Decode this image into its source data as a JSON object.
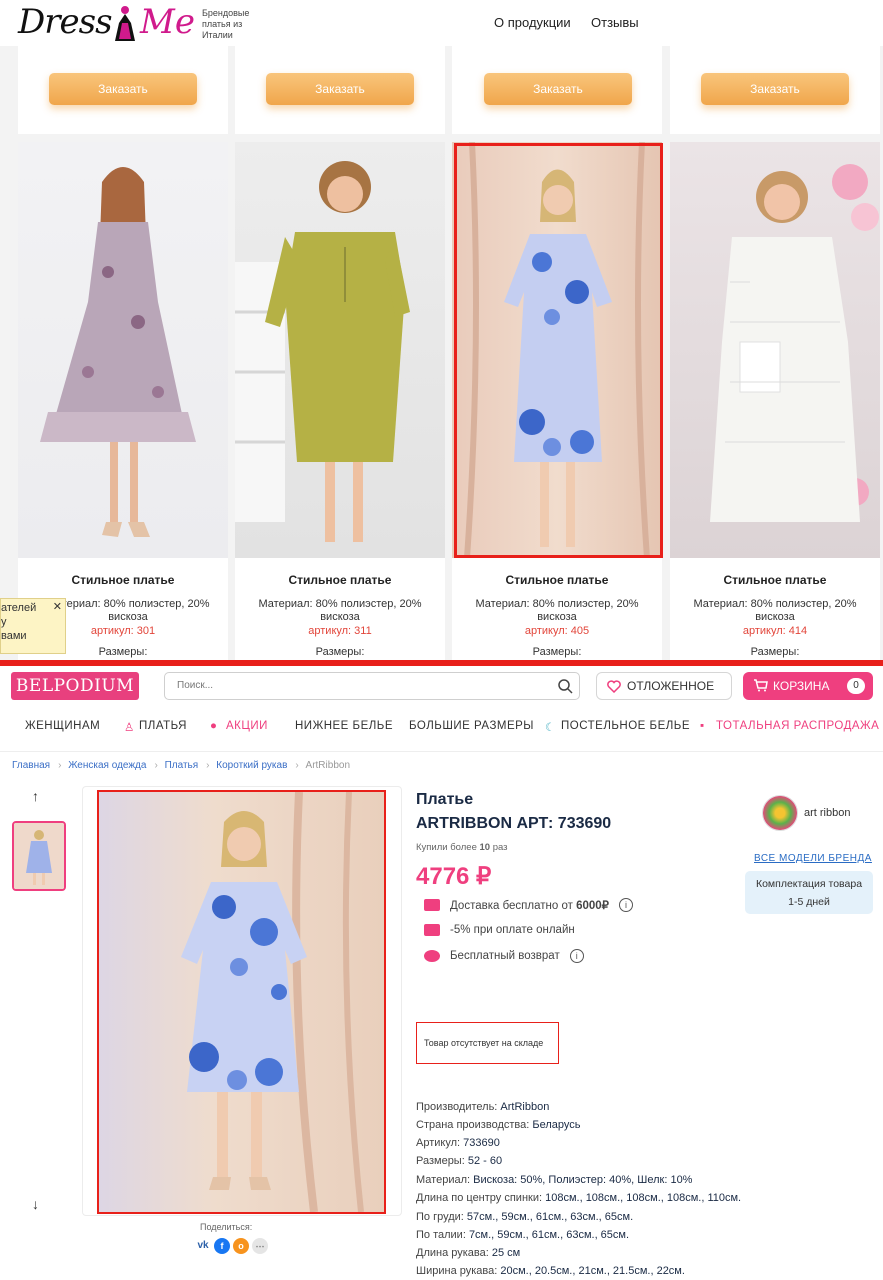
{
  "top_site": {
    "logo_left": "Dress",
    "logo_right": "Me",
    "tagline": "Брендовые платья из Италии",
    "nav": [
      "О продукции",
      "Отзывы"
    ],
    "order_label": "Заказать",
    "popup_text": "ателей\nу\nвами",
    "products": [
      {
        "title": "Стильное платье",
        "material": "Материал: 80% полиэстер, 20% вискоза",
        "article": "артикул: 301",
        "sizes": "Размеры:"
      },
      {
        "title": "Стильное платье",
        "material": "Материал: 80% полиэстер, 20% вискоза",
        "article": "артикул: 311",
        "sizes": "Размеры:"
      },
      {
        "title": "Стильное платье",
        "material": "Материал: 80% полиэстер, 20% вискоза",
        "article": "артикул: 405",
        "sizes": "Размеры:"
      },
      {
        "title": "Стильное платье",
        "material": "Материал: 80% полиэстер, 20% вискоза",
        "article": "артикул: 414",
        "sizes": "Размеры:"
      }
    ]
  },
  "bp": {
    "logo": "BELPODIUM",
    "search_placeholder": "Поиск...",
    "favorites_label": "ОТЛОЖЕННОЕ",
    "cart_label": "КОРЗИНА",
    "cart_count": "0",
    "menu": [
      "ЖЕНЩИНАМ",
      "ПЛАТЬЯ",
      "АКЦИИ",
      "НИЖНЕЕ БЕЛЬЕ",
      "БОЛЬШИЕ РАЗМЕРЫ",
      "ПОСТЕЛЬНОЕ БЕЛЬЕ",
      "ТОТАЛЬНАЯ РАСПРОДАЖА"
    ],
    "breadcrumb": [
      "Главная",
      "Женская одежда",
      "Платья",
      "Короткий рукав",
      "ArtRibbon"
    ],
    "product": {
      "title_line1": "Платье",
      "title_line2": "ARTRIBBON АРТ: 733690",
      "bought_prefix": "Купили более ",
      "bought_count": "10",
      "bought_suffix": " раз",
      "price": "4776 ₽",
      "delivery": "Доставка бесплатно от ",
      "delivery_amount": "6000₽",
      "discount": "-5% при оплате онлайн",
      "return": "Бесплатный возврат",
      "out_of_stock": "Товар отсутствует на складе"
    },
    "brand": {
      "name": "art ribbon",
      "all_models": "ВСЕ МОДЕЛИ БРЕНДА",
      "kit_label": "Комплектация товара",
      "kit_days": "1-5 дней"
    },
    "share_label": "Поделиться:",
    "specs": [
      {
        "label": "Производитель: ",
        "value": "ArtRibbon"
      },
      {
        "label": "Страна производства: ",
        "value": "Беларусь"
      },
      {
        "label": "Артикул: ",
        "value": "733690"
      },
      {
        "label": "Размеры: ",
        "value": "52 - 60"
      },
      {
        "label": "Материал: ",
        "value": "Вискоза: 50%, Полиэстер: 40%, Шелк: 10%"
      },
      {
        "label": "Длина по центру спинки: ",
        "value": "108см., 108см., 108см., 108см., 110см."
      },
      {
        "label": "По груди: ",
        "value": "57см., 59см., 61см., 63см., 65см."
      },
      {
        "label": "По талии: ",
        "value": "7см., 59см., 61см., 63см., 65см."
      },
      {
        "label": "Длина рукава: ",
        "value": "25 см"
      },
      {
        "label": "Ширина рукава: ",
        "value": "20см., 20.5см., 21см., 21.5см., 22см."
      }
    ]
  },
  "colors": {
    "accent_pink": "#ef3f7f",
    "highlight_red": "#e8201a",
    "article_red": "#e2453a",
    "order_orange": "#f0a64b"
  }
}
